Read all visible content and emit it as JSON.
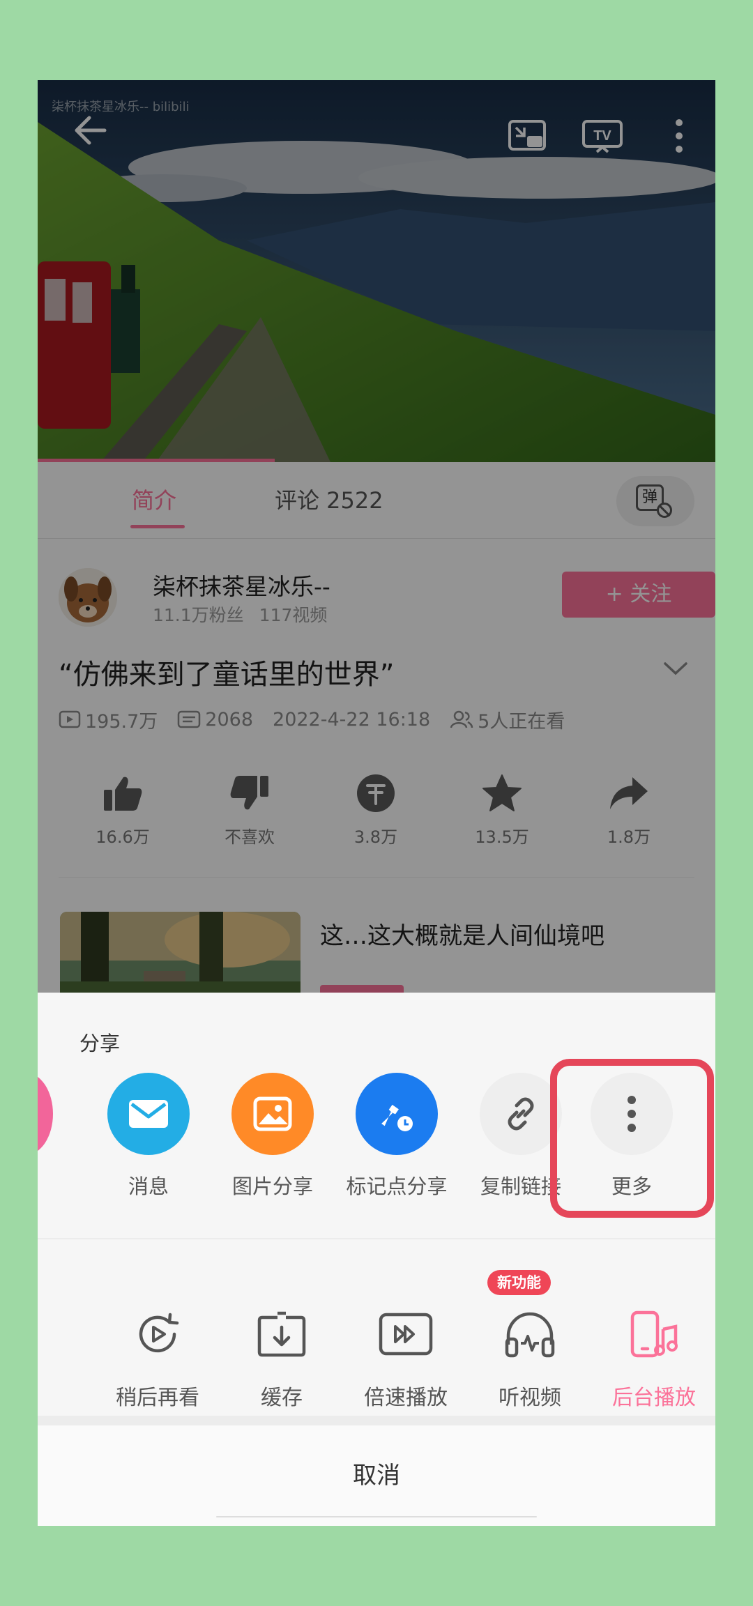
{
  "player": {
    "watermark": "柒杯抹茶星冰乐-- bilibili"
  },
  "tabs": [
    {
      "label": "简介"
    },
    {
      "label": "评论 2522"
    }
  ],
  "danmaku_toggle": {
    "label": "弹"
  },
  "uploader": {
    "name": "柒杯抹茶星冰乐--",
    "fans": "11.1万粉丝",
    "videos": "117视频",
    "follow_label": "+ 关注"
  },
  "video": {
    "title": "“仿佛来到了童话里的世界”",
    "plays": "195.7万",
    "danmaku": "2068",
    "date": "2022-4-22 16:18",
    "watching": "5人正在看"
  },
  "actions": [
    {
      "icon": "thumb-up-icon",
      "label": "16.6万"
    },
    {
      "icon": "thumb-down-icon",
      "label": "不喜欢"
    },
    {
      "icon": "coin-icon",
      "label": "3.8万"
    },
    {
      "icon": "star-icon",
      "label": "13.5万"
    },
    {
      "icon": "share-arrow-icon",
      "label": "1.8万"
    }
  ],
  "related": {
    "title": "这…这大概就是人间仙境吧"
  },
  "share_sheet": {
    "title": "分享",
    "targets": [
      {
        "icon": "mail-icon",
        "label": "消息",
        "color": "#23ade5"
      },
      {
        "icon": "image-icon",
        "label": "图片分享",
        "color": "#ff8a27"
      },
      {
        "icon": "pin-clock-icon",
        "label": "标记点分享",
        "color": "#1b7cf0"
      },
      {
        "icon": "link-icon",
        "label": "复制链接",
        "color": "#eeeeee"
      },
      {
        "icon": "more-vertical-icon",
        "label": "更多",
        "color": "#eeeeee"
      }
    ],
    "tools": [
      {
        "icon": "watch-later-icon",
        "label": "稍后再看"
      },
      {
        "icon": "download-icon",
        "label": "缓存"
      },
      {
        "icon": "speed-icon",
        "label": "倍速播放"
      },
      {
        "icon": "headphones-icon",
        "label": "听视频"
      },
      {
        "icon": "background-play-icon",
        "label": "后台播放"
      }
    ],
    "new_badge": "新功能",
    "cancel_label": "取消"
  },
  "colors": {
    "accent": "#fb7299",
    "highlight": "#e54659",
    "background": "#9ed9a4"
  }
}
